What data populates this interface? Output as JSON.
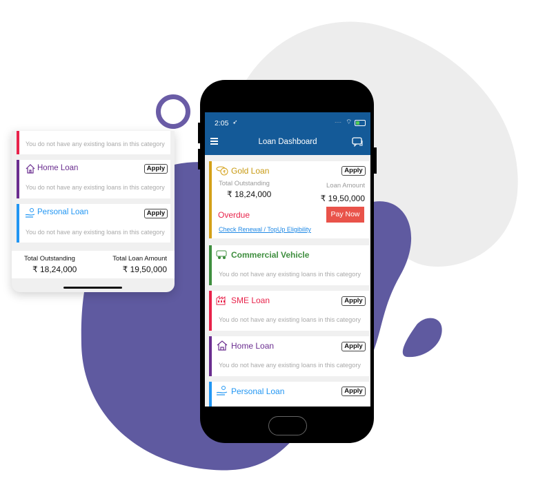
{
  "main_phone": {
    "status_bar": {
      "time": "2:05",
      "location_icon": "location-arrow-icon",
      "signal": "....",
      "wifi_icon": "wifi-icon",
      "battery_icon": "battery-charging-icon"
    },
    "app_bar": {
      "title": "Loan Dashboard",
      "menu_icon": "hamburger-menu-icon",
      "chat_icon": "chat-bubbles-icon"
    },
    "cards": {
      "gold": {
        "title": "Gold Loan",
        "apply": "Apply",
        "total_outstanding_label": "Total Outstanding",
        "total_outstanding": "₹ 18,24,000",
        "loan_amount_label": "Loan Amount",
        "loan_amount": "₹ 19,50,000",
        "status": "Overdue",
        "pay_now": "Pay Now",
        "link": "Check Renewal / TopUp Eligibility",
        "color": "#d4a017"
      },
      "commercial": {
        "title": "Commercial Vehicle",
        "message": "You do not have any existing loans in this category",
        "color": "#3e8e3e"
      },
      "sme": {
        "title": "SME Loan",
        "apply": "Apply",
        "message": "You do not have any existing loans in this category",
        "color": "#e8224a"
      },
      "home": {
        "title": "Home Loan",
        "apply": "Apply",
        "message": "You do not have any existing loans in this category",
        "color": "#6a2d8f"
      },
      "personal": {
        "title": "Personal Loan",
        "apply": "Apply",
        "color": "#2196f3"
      }
    }
  },
  "side_panel": {
    "top_message": "You do not have any existing loans in this category",
    "home": {
      "title": "Home Loan",
      "apply": "Apply",
      "message": "You do not have any existing loans in this category"
    },
    "personal": {
      "title": "Personal Loan",
      "apply": "Apply",
      "message": "You do not have any existing loans in this category"
    },
    "totals": {
      "outstanding_label": "Total Outstanding",
      "outstanding": "₹ 18,24,000",
      "loan_label": "Total Loan Amount",
      "loan": "₹ 19,50,000"
    }
  },
  "colors": {
    "app_bar": "#145a98",
    "pay_now": "#e9534a",
    "overdue": "#e8224a",
    "link": "#1e88e5",
    "blob": "#5f5aa0"
  }
}
